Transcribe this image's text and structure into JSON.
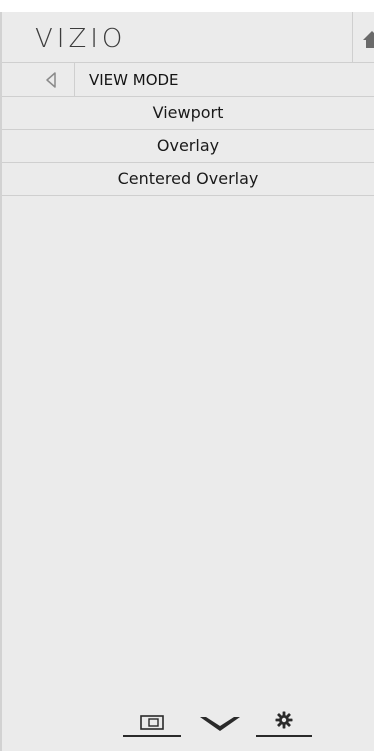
{
  "header": {
    "logo": "VIZIO",
    "home_icon": "home-icon"
  },
  "title_bar": {
    "back_icon": "back-arrow-icon",
    "title": "VIEW MODE"
  },
  "menu": {
    "items": [
      {
        "label": "Viewport"
      },
      {
        "label": "Overlay"
      },
      {
        "label": "Centered Overlay"
      }
    ]
  },
  "bottom_bar": {
    "buttons": [
      {
        "icon": "input-icon"
      },
      {
        "icon": "chevron-down-icon"
      },
      {
        "icon": "gear-icon"
      }
    ]
  },
  "colors": {
    "panel_bg": "#ebebeb",
    "divider": "#cfcfcf",
    "text": "#1a1a1a"
  }
}
